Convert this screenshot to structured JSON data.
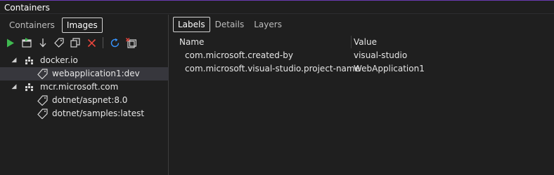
{
  "window": {
    "title": "Containers",
    "accent_color": "#6a3bb3"
  },
  "left_tabs": [
    {
      "label": "Containers",
      "active": false
    },
    {
      "label": "Images",
      "active": true
    }
  ],
  "toolbar": {
    "icons": [
      "start-icon",
      "attach-terminal-icon",
      "pull-icon",
      "tag-icon",
      "copy-icon",
      "remove-icon",
      "refresh-icon",
      "prune-icon"
    ]
  },
  "tree": {
    "registries": [
      {
        "name": "docker.io",
        "images": [
          {
            "name": "webapplication1:dev",
            "selected": true
          }
        ]
      },
      {
        "name": "mcr.microsoft.com",
        "images": [
          {
            "name": "dotnet/aspnet:8.0",
            "selected": false
          },
          {
            "name": "dotnet/samples:latest",
            "selected": false
          }
        ]
      }
    ]
  },
  "right_tabs": [
    {
      "label": "Labels",
      "active": true
    },
    {
      "label": "Details",
      "active": false
    },
    {
      "label": "Layers",
      "active": false
    }
  ],
  "labels_table": {
    "columns": [
      "Name",
      "Value"
    ],
    "rows": [
      {
        "name": "com.microsoft.created-by",
        "value": "visual-studio"
      },
      {
        "name": "com.microsoft.visual-studio.project-name",
        "value": "WebApplication1"
      }
    ]
  }
}
